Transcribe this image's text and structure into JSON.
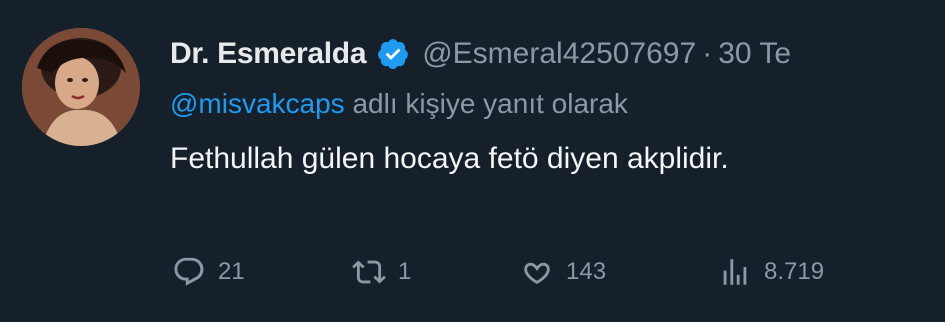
{
  "tweet": {
    "author": {
      "display_name": "Dr. Esmeralda",
      "handle": "@Esmeral42507697",
      "separator": "·",
      "date": "30 Te",
      "verified": true,
      "avatar_icon": "profile-avatar"
    },
    "reply": {
      "mention": "@misvakcaps",
      "suffix": " adlı kişiye yanıt olarak"
    },
    "text": "Fethullah gülen hocaya fetö diyen akplidir.",
    "stats": {
      "replies": "21",
      "retweets": "1",
      "likes": "143",
      "views": "8.719"
    },
    "icons": {
      "reply": "reply-icon",
      "retweet": "retweet-icon",
      "like": "heart-icon",
      "views": "views-icon",
      "verified": "verified-badge-icon"
    },
    "colors": {
      "background": "#15202b",
      "link": "#1d9bf0",
      "secondary_text": "#8b98a5",
      "primary_text": "#e7e9ea"
    }
  }
}
